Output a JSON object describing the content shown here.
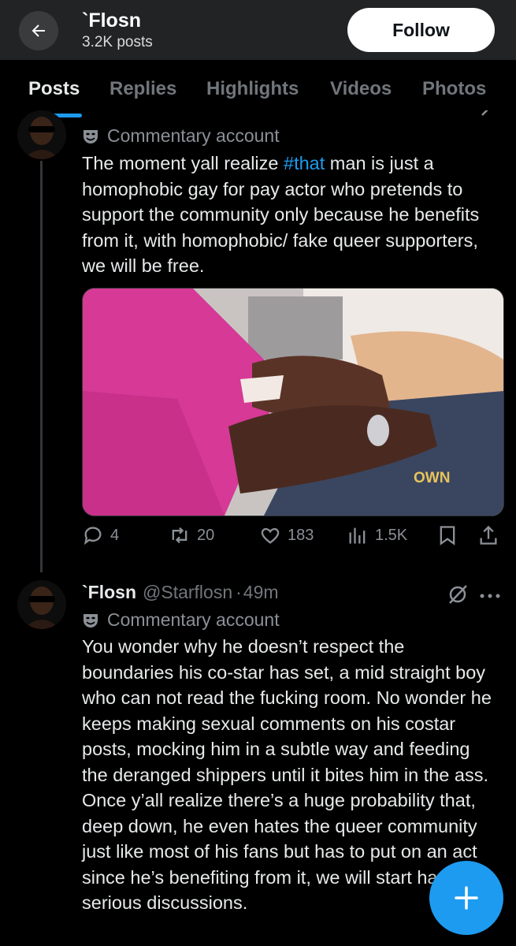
{
  "header": {
    "title": "`Flosn",
    "subtitle": "3.2K posts",
    "follow_label": "Follow"
  },
  "tabs": [
    "Posts",
    "Replies",
    "Highlights",
    "Videos",
    "Photos"
  ],
  "active_tab": "Posts",
  "post1": {
    "label": "Commentary account",
    "text_before": "The moment yall realize ",
    "hashtag": "#that",
    "text_after": " man is just a homophobic gay for pay actor who pretends to support the community only because he benefits from it, with homophobic/ fake queer supporters, we will be free.",
    "media_watermark": "OWN",
    "stats": {
      "replies": "4",
      "reposts": "20",
      "likes": "183",
      "views": "1.5K"
    }
  },
  "post2": {
    "display_name": "`Flosn",
    "handle": "@Starflosn",
    "separator": "·",
    "time": "49m",
    "label": "Commentary account",
    "text": "You wonder why he doesn’t respect the boundaries his co-star has set, a mid straight boy who can not read the fucking room. No wonder he keeps making sexual comments on his costar posts, mocking him in a subtle way and feeding the deranged shippers until it bites him in the ass. Once y’all realize there’s a huge probability that, deep down, he even hates the queer community just like most of his fans but has to put on an act since he’s benefiting from it, we will start having serious discussions."
  },
  "colors": {
    "accent": "#1d9bf0",
    "background": "#000000",
    "header": "#222325"
  },
  "icons": [
    "back-arrow-icon",
    "comedy-mask-icon",
    "reply-icon",
    "repost-icon",
    "like-icon",
    "views-icon",
    "bookmark-icon",
    "share-icon",
    "grok-icon",
    "more-icon",
    "compose-plus-icon"
  ]
}
